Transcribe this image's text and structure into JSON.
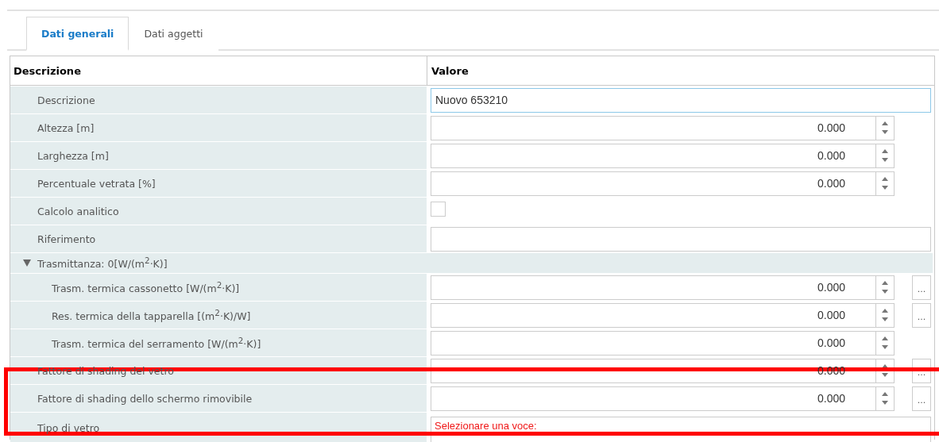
{
  "tabs": [
    {
      "label": "Dati generali",
      "selected": true
    },
    {
      "label": "Dati aggetti",
      "selected": false
    }
  ],
  "table": {
    "columns": [
      "Descrizione",
      "Valore"
    ],
    "rows": [
      {
        "label": "Descrizione",
        "kind": "text",
        "value": "Nuovo 653210",
        "focused": true
      },
      {
        "label": "Altezza [m]",
        "kind": "number",
        "value": "0.000"
      },
      {
        "label": "Larghezza [m]",
        "kind": "number",
        "value": "0.000"
      },
      {
        "label": "Percentuale vetrata [%]",
        "kind": "number",
        "value": "0.000"
      },
      {
        "label": "Calcolo analitico",
        "kind": "checkbox",
        "checked": false
      },
      {
        "label": "Riferimento",
        "kind": "text",
        "value": "",
        "focused": false
      },
      {
        "label": "Trasmittanza: 0[W/(m$^{2}$·K)]",
        "kind": "group",
        "expanded": true,
        "children": [
          {
            "label": "Trasm. termica cassonetto [W/(m$^{2}$·K)]",
            "kind": "number",
            "value": "0.000",
            "button": "..."
          },
          {
            "label": "Res. termica della tapparella [(m$^{2}$·K)/W]",
            "kind": "number",
            "value": "0.000",
            "button": "..."
          },
          {
            "label": "Trasm. termica del serramento [W/(m$^{2}$·K)]",
            "kind": "number",
            "value": "0.000"
          }
        ]
      },
      {
        "label": "Fattore di shading del vetro",
        "kind": "number",
        "value": "0.000",
        "button": "..."
      },
      {
        "label": "Fattore di shading dello schermo rimovibile",
        "kind": "number",
        "value": "0.000",
        "button": "..."
      },
      {
        "label": "Tipo di vetro",
        "kind": "select",
        "placeholder": "Selezionare una voce:"
      }
    ]
  }
}
